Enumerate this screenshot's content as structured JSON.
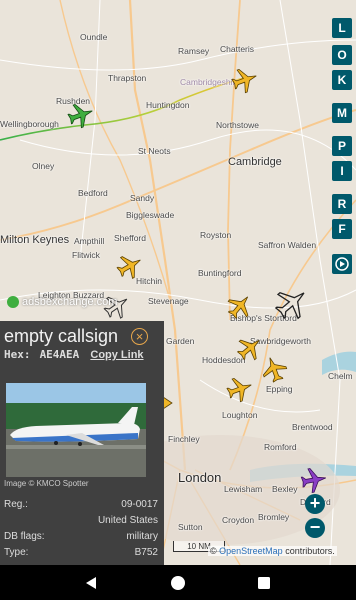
{
  "map": {
    "places": [
      {
        "name": "Oundle",
        "cls": "place"
      },
      {
        "name": "Ramsey",
        "cls": "place"
      },
      {
        "name": "Chatteris",
        "cls": "place"
      },
      {
        "name": "Thrapston",
        "cls": "place"
      },
      {
        "name": "Cambridgeshire",
        "cls": "place purple"
      },
      {
        "name": "Huntingdon",
        "cls": "place"
      },
      {
        "name": "Wellingborough",
        "cls": "place"
      },
      {
        "name": "Rushden",
        "cls": "place"
      },
      {
        "name": "St Neots",
        "cls": "place"
      },
      {
        "name": "Northstowe",
        "cls": "place"
      },
      {
        "name": "Bedford",
        "cls": "place"
      },
      {
        "name": "Cambridge",
        "cls": "place big"
      },
      {
        "name": "Olney",
        "cls": "place"
      },
      {
        "name": "Sandy",
        "cls": "place"
      },
      {
        "name": "Biggleswade",
        "cls": "place"
      },
      {
        "name": "Milton Keynes",
        "cls": "place big"
      },
      {
        "name": "Ampthill",
        "cls": "place"
      },
      {
        "name": "Shefford",
        "cls": "place"
      },
      {
        "name": "Royston",
        "cls": "place"
      },
      {
        "name": "Saffron Walden",
        "cls": "place"
      },
      {
        "name": "Flitwick",
        "cls": "place"
      },
      {
        "name": "Hitchin",
        "cls": "place"
      },
      {
        "name": "Buntingford",
        "cls": "place"
      },
      {
        "name": "Leighton Buzzard",
        "cls": "place"
      },
      {
        "name": "Stevenage",
        "cls": "place"
      },
      {
        "name": "Garden",
        "cls": "place"
      },
      {
        "name": "Bishop's Stortford",
        "cls": "place"
      },
      {
        "name": "Sawbridgeworth",
        "cls": "place"
      },
      {
        "name": "Hoddesdon",
        "cls": "place"
      },
      {
        "name": "Chelm",
        "cls": "place"
      },
      {
        "name": "Epping",
        "cls": "place"
      },
      {
        "name": "Loughton",
        "cls": "place"
      },
      {
        "name": "Brentwood",
        "cls": "place"
      },
      {
        "name": "Finchley",
        "cls": "place"
      },
      {
        "name": "Romford",
        "cls": "place"
      },
      {
        "name": "London",
        "cls": "place city"
      },
      {
        "name": "Lewisham",
        "cls": "place"
      },
      {
        "name": "Bexley",
        "cls": "place"
      },
      {
        "name": "Dartford",
        "cls": "place"
      },
      {
        "name": "Croydon",
        "cls": "place"
      },
      {
        "name": "Sutton",
        "cls": "place"
      },
      {
        "name": "Bromley",
        "cls": "place"
      }
    ],
    "watermark": "adsbexchange.com",
    "scale_label": "10 NM",
    "attribution_prefix": "© ",
    "attribution_link": "OpenStreetMap",
    "attribution_suffix": " contributors.",
    "colors": {
      "map_bg": "#eae4da",
      "water": "#aad3df",
      "road_major": "#f7c98f",
      "road": "#ffffff",
      "plane_yellow": "#f0b626",
      "plane_green": "#3fae3f",
      "plane_purple": "#8a3ec4"
    }
  },
  "side_buttons": [
    "L",
    "O",
    "K",
    "M",
    "P",
    "I",
    "R",
    "F"
  ],
  "zoom": {
    "in": "+",
    "out": "−"
  },
  "panel": {
    "callsign": "empty callsign",
    "close_symbol": "×",
    "hex_label": "Hex:",
    "hex_value": "AE4AEA",
    "copy_link": "Copy Link",
    "photo_credit": "Image © KMCO Spotter",
    "reg_label": "Reg.:",
    "reg_value": "09-0017",
    "country": "United States",
    "db_flags_label": "DB flags:",
    "db_flags_value": "military",
    "type_label": "Type:",
    "type_value": "B752"
  },
  "navbar": {
    "back": "back-icon",
    "home": "home-icon",
    "recents": "recents-icon"
  }
}
